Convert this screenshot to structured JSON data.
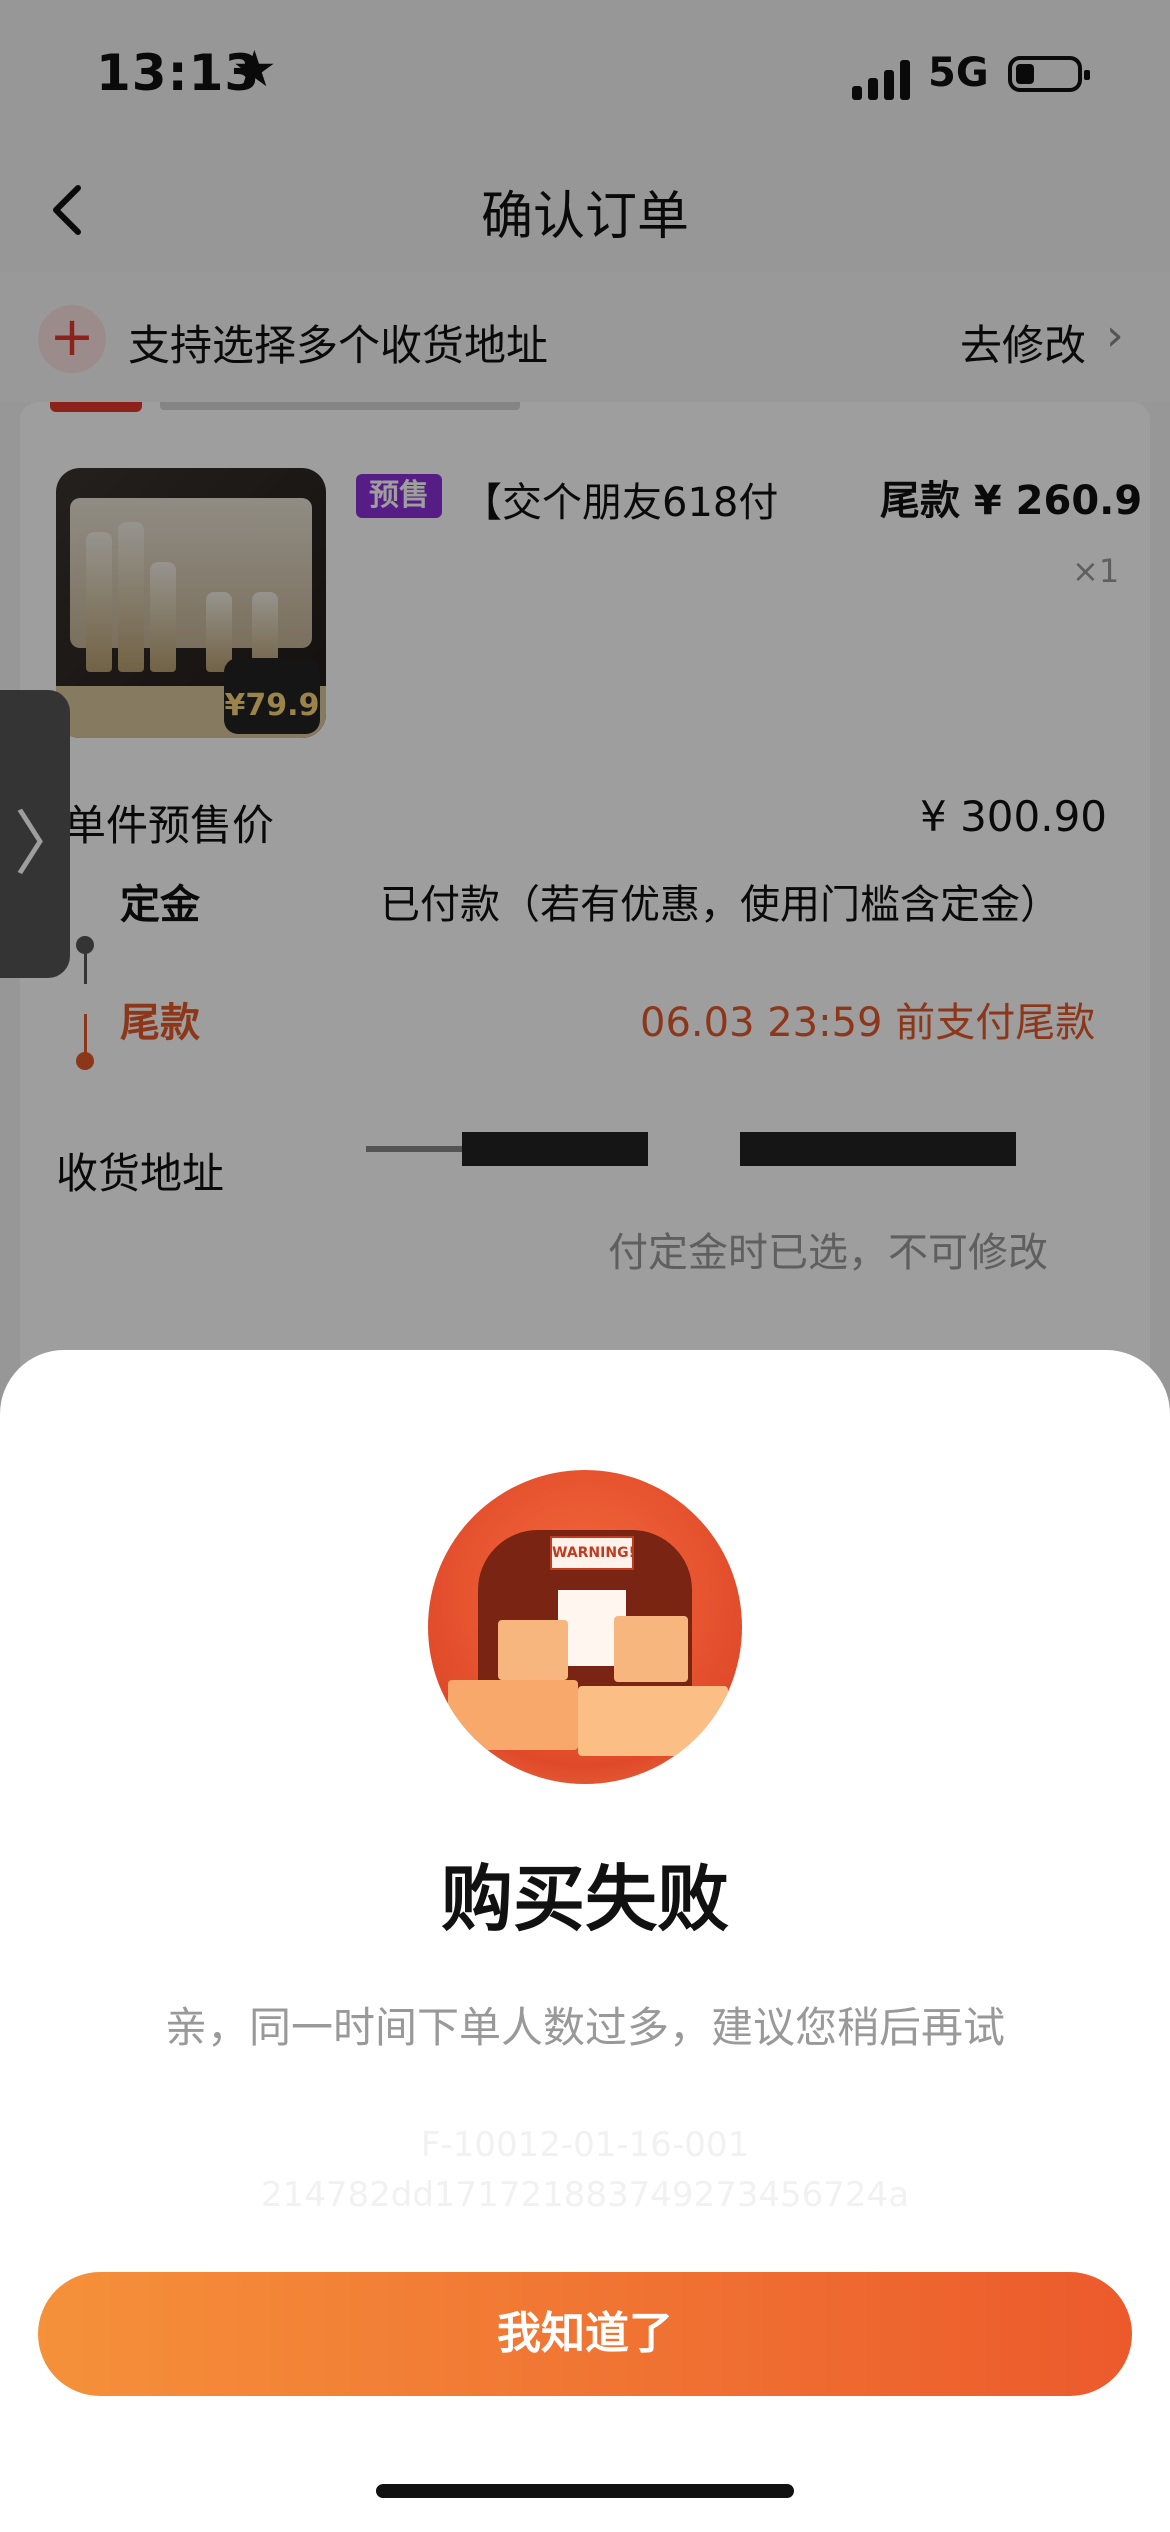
{
  "status_bar": {
    "time": "13:13",
    "network": "5G"
  },
  "nav": {
    "title": "确认订单"
  },
  "address_tip": {
    "text": "支持选择多个收货地址",
    "edit": "去修改"
  },
  "product": {
    "badge": "预售",
    "title": "【交个朋友618付",
    "final_price": "尾款 ¥ 260.9",
    "quantity": "×1",
    "image_tag_price": "¥79.9"
  },
  "presale": {
    "unit_price_label": "单件预售价",
    "unit_price_value": "¥ 300.90",
    "deposit_label": "定金",
    "deposit_value": "已付款（若有优惠，使用门槛含定金）",
    "balance_label": "尾款",
    "balance_value": "06.03 23:59 前支付尾款"
  },
  "address": {
    "label": "收货地址",
    "note": "付定金时已选，不可修改"
  },
  "dialog": {
    "title": "购买失败",
    "message": "亲，同一时间下单人数过多，建议您稍后再试",
    "code_line1": "F-10012-01-16-001",
    "code_line2": "214782dd171721883749273456724a",
    "warning_text": "WARNING!",
    "button": "我知道了"
  },
  "colors": {
    "accent": "#ec5a2c",
    "presale_badge": "#8b2fd8",
    "balance": "#e2572b"
  }
}
